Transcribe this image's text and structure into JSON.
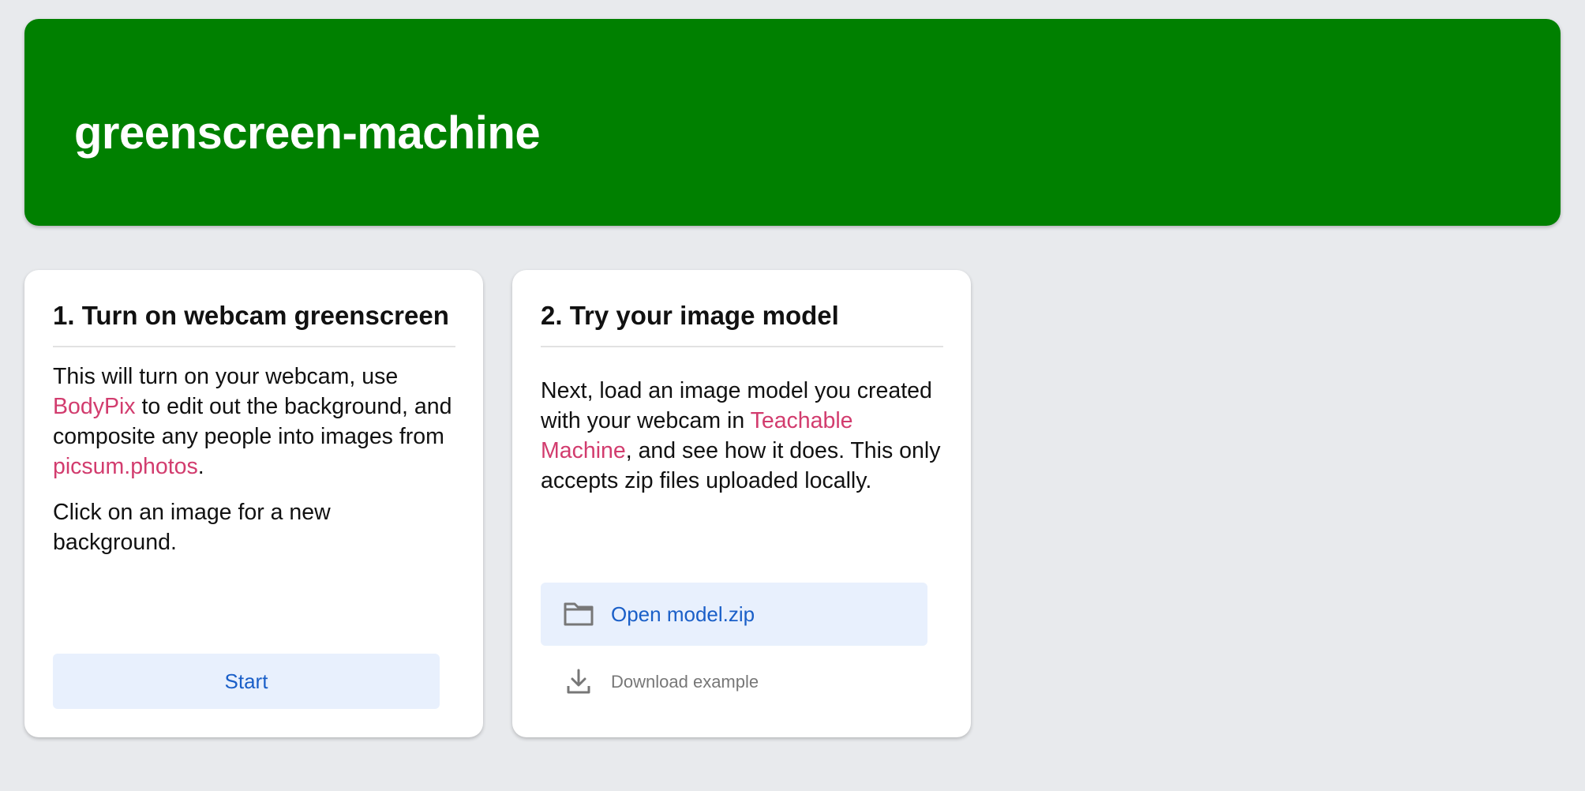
{
  "header": {
    "title": "greenscreen-machine"
  },
  "card1": {
    "title": "1. Turn on webcam greenscreen",
    "desc_part1": "This will turn on your webcam, use ",
    "link_bodypix": "BodyPix",
    "desc_part2": " to edit out the background, and composite any people into images from ",
    "link_picsum": "picsum.photos",
    "desc_part3": ".",
    "desc2": "Click on an image for a new background.",
    "start_label": "Start"
  },
  "card2": {
    "title": "2. Try your image model",
    "desc_part1": "Next, load an image model you created with your webcam in ",
    "link_teachable": "Teachable Machine",
    "desc_part2": ", and see how it does. This only accepts zip files uploaded locally.",
    "open_label": "Open model.zip",
    "open_icon": "folder-icon",
    "download_label": "Download example",
    "download_icon": "download-icon"
  },
  "colors": {
    "header_bg": "#008000",
    "page_bg": "#e8eaed",
    "link": "#d23c6e",
    "button_bg": "#e8f0fd",
    "button_text": "#1a5fc8"
  }
}
